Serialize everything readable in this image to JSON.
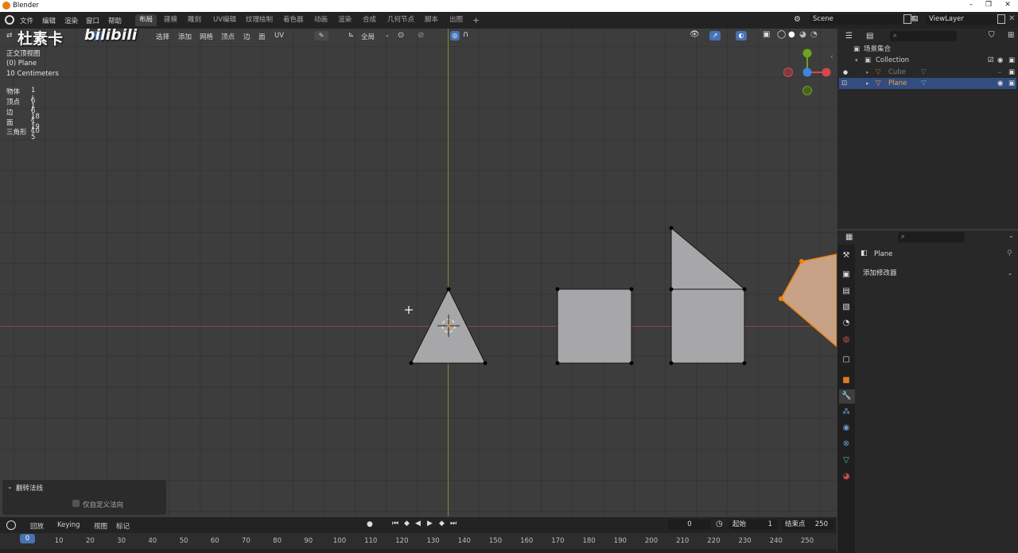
{
  "window": {
    "title": "Blender",
    "controls": [
      "–",
      "❐",
      "✕"
    ]
  },
  "menubar": {
    "items": [
      "文件",
      "编辑",
      "渲染",
      "窗口",
      "帮助"
    ]
  },
  "workspaces": {
    "tabs": [
      "布局",
      "建模",
      "雕刻",
      "UV编辑",
      "纹理绘制",
      "着色器",
      "动画",
      "渲染",
      "合成",
      "几何节点",
      "脚本",
      "出图"
    ],
    "active": "布局",
    "add": "+"
  },
  "scene": {
    "scene_name": "Scene",
    "view_layer": "ViewLayer"
  },
  "watermark": {
    "text": "杜素卡",
    "brand": "bilibili"
  },
  "viewport_header": {
    "menus": [
      "选择",
      "添加",
      "网格",
      "顶点",
      "边",
      "面",
      "UV"
    ],
    "transform_orientation": "全局"
  },
  "viewport_overlay": {
    "view_name": "正交顶视图",
    "object_name": "(0) Plane",
    "scale": "10 Centimeters",
    "stats": [
      {
        "label": "物体",
        "value": "1 / 1"
      },
      {
        "label": "顶点",
        "value": "6 / 18"
      },
      {
        "label": "边",
        "value": "6 / 19"
      },
      {
        "label": "面",
        "value": "1 / 5"
      },
      {
        "label": "三角形",
        "value": "10"
      }
    ]
  },
  "gizmo": {
    "x": "X",
    "y": "Y",
    "z": "Z"
  },
  "operator_panel": {
    "title": "翻转法线",
    "option_label": "仅自定义法向",
    "option_checked": false
  },
  "timeline": {
    "menus": [
      "回放",
      "Keying",
      "视图",
      "标记"
    ],
    "current_frame": "0",
    "start_label": "起始",
    "start_value": "1",
    "end_label": "结束点",
    "end_value": "250",
    "ruler": [
      "0",
      "10",
      "20",
      "30",
      "40",
      "50",
      "60",
      "70",
      "80",
      "90",
      "100",
      "110",
      "120",
      "130",
      "140",
      "150",
      "160",
      "170",
      "180",
      "190",
      "200",
      "210",
      "220",
      "230",
      "240",
      "250"
    ]
  },
  "outliner": {
    "root": "场景集合",
    "items": [
      {
        "name": "Collection",
        "depth": 1
      },
      {
        "name": "Cube",
        "depth": 2,
        "hidden": true
      },
      {
        "name": "Plane",
        "depth": 2,
        "selected": true
      }
    ]
  },
  "properties": {
    "object_name": "Plane",
    "add_modifier": "添加修改器"
  },
  "colors": {
    "accent": "#4772b3",
    "selected_row": "#334d80",
    "orange": "#f0820d",
    "mesh_face": "#a7a7a9",
    "x_axis": "#a04848",
    "y_axis": "#88892f"
  }
}
